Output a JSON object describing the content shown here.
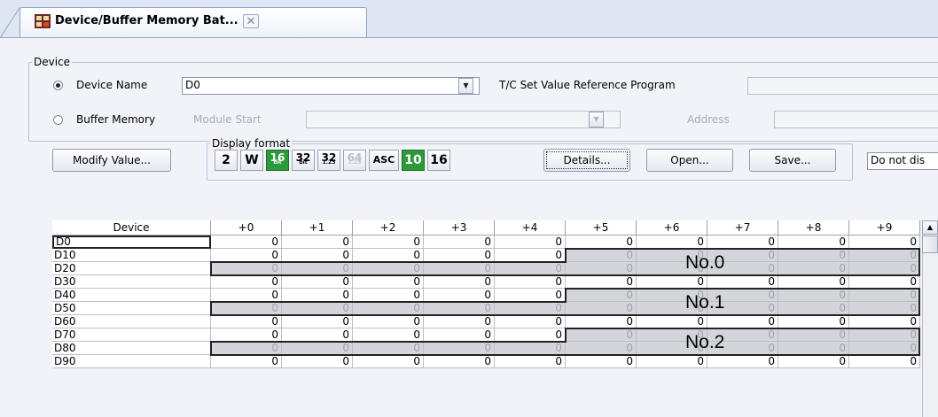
{
  "tab": {
    "title": "Device/Buffer Memory Bat...",
    "close": "✕"
  },
  "device_group": {
    "legend": "Device",
    "device_name_label": "Device Name",
    "device_name_value": "D0",
    "tc_label": "T/C Set Value Reference Program",
    "tc_value": "",
    "buffer_label": "Buffer Memory",
    "module_start_label": "Module Start",
    "module_start_value": "",
    "address_label": "Address",
    "address_value": ""
  },
  "toolbar": {
    "modify_label": "Modify Value...",
    "display_format_legend": "Display format",
    "formats": [
      "2",
      "W",
      "16",
      "32",
      "32",
      "64",
      "ASC",
      "10",
      "16"
    ],
    "format_subs": [
      "",
      "",
      "bit",
      "bit",
      "1.23",
      "1.23",
      "",
      "",
      ""
    ],
    "details_label": "Details...",
    "open_label": "Open...",
    "save_label": "Save...",
    "display_option": "Do not dis"
  },
  "table": {
    "columns": [
      "Device",
      "+0",
      "+1",
      "+2",
      "+3",
      "+4",
      "+5",
      "+6",
      "+7",
      "+8",
      "+9"
    ],
    "rows": [
      {
        "device": "D0",
        "values": [
          "0",
          "0",
          "0",
          "0",
          "0",
          "0",
          "0",
          "0",
          "0",
          "0"
        ]
      },
      {
        "device": "D10",
        "values": [
          "0",
          "0",
          "0",
          "0",
          "0",
          "0",
          "0",
          "0",
          "0",
          "0"
        ]
      },
      {
        "device": "D20",
        "values": [
          "0",
          "0",
          "0",
          "0",
          "0",
          "0",
          "0",
          "0",
          "0",
          "0"
        ]
      },
      {
        "device": "D30",
        "values": [
          "0",
          "0",
          "0",
          "0",
          "0",
          "0",
          "0",
          "0",
          "0",
          "0"
        ]
      },
      {
        "device": "D40",
        "values": [
          "0",
          "0",
          "0",
          "0",
          "0",
          "0",
          "0",
          "0",
          "0",
          "0"
        ]
      },
      {
        "device": "D50",
        "values": [
          "0",
          "0",
          "0",
          "0",
          "0",
          "0",
          "0",
          "0",
          "0",
          "0"
        ]
      },
      {
        "device": "D60",
        "values": [
          "0",
          "0",
          "0",
          "0",
          "0",
          "0",
          "0",
          "0",
          "0",
          "0"
        ]
      },
      {
        "device": "D70",
        "values": [
          "0",
          "0",
          "0",
          "0",
          "0",
          "0",
          "0",
          "0",
          "0",
          "0"
        ]
      },
      {
        "device": "D80",
        "values": [
          "0",
          "0",
          "0",
          "0",
          "0",
          "0",
          "0",
          "0",
          "0",
          "0"
        ]
      },
      {
        "device": "D90",
        "values": [
          "0",
          "0",
          "0",
          "0",
          "0",
          "0",
          "0",
          "0",
          "0",
          "0"
        ]
      }
    ],
    "zones": [
      {
        "label": "No.0"
      },
      {
        "label": "No.1"
      },
      {
        "label": "No.2"
      }
    ]
  }
}
